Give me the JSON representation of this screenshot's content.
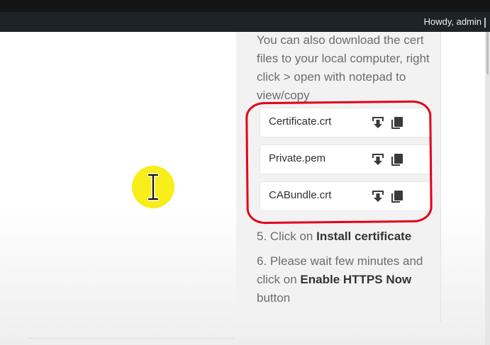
{
  "adminbar": {
    "greeting": "Howdy, admin"
  },
  "instructions": {
    "intro": "You can also download the cert files to your local computer, right click > open with notepad to view/copy",
    "files": [
      {
        "name": "Certificate.crt",
        "download_icon": "download-icon",
        "copy_icon": "copy-icon"
      },
      {
        "name": "Private.pem",
        "download_icon": "download-icon",
        "copy_icon": "copy-icon"
      },
      {
        "name": "CABundle.crt",
        "download_icon": "download-icon",
        "copy_icon": "copy-icon"
      }
    ],
    "step5": {
      "prefix": "5. Click on ",
      "strong": "Install certificate"
    },
    "step6": {
      "prefix": "6. Please wait few minutes and click on ",
      "strong": "Enable HTTPS Now",
      "suffix": " button"
    }
  },
  "annotation": {
    "highlight_color": "#e3001b"
  },
  "cursor": {
    "icon": "text-cursor-icon",
    "highlight_color": "#f7ee1a"
  }
}
